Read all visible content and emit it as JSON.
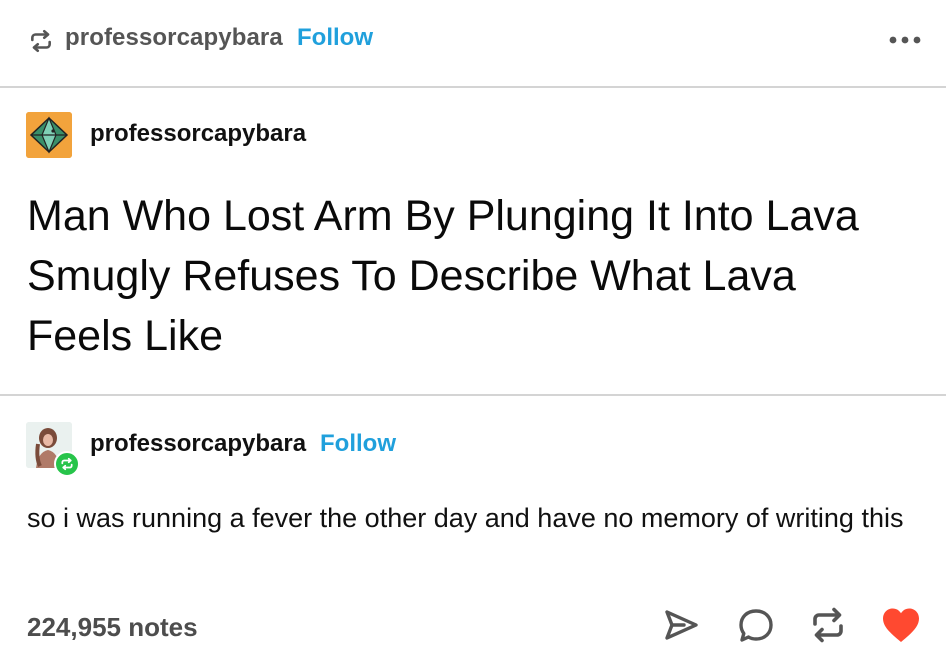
{
  "header": {
    "username": "professorcapybara",
    "follow_label": "Follow",
    "more_icon": "more-horizontal-icon"
  },
  "original_post": {
    "username": "professorcapybara",
    "avatar_icon": "geometric-logo-avatar",
    "avatar_color": "#f2a33c",
    "title": "Man Who Lost Arm By Plunging It Into Lava Smugly Refuses To Describe What Lava Feels Like"
  },
  "reblog": {
    "username": "professorcapybara",
    "follow_label": "Follow",
    "comment": "so i was running a fever the other day and have no memory of writing this",
    "badge_color": "#27c44a"
  },
  "footer": {
    "notes": "224,955 notes",
    "like_color": "#ff4930",
    "actions": [
      "share-icon",
      "reply-icon",
      "reblog-icon",
      "like-icon"
    ]
  },
  "colors": {
    "follow_link": "#20a0dc",
    "divider": "#d4d4d4"
  }
}
